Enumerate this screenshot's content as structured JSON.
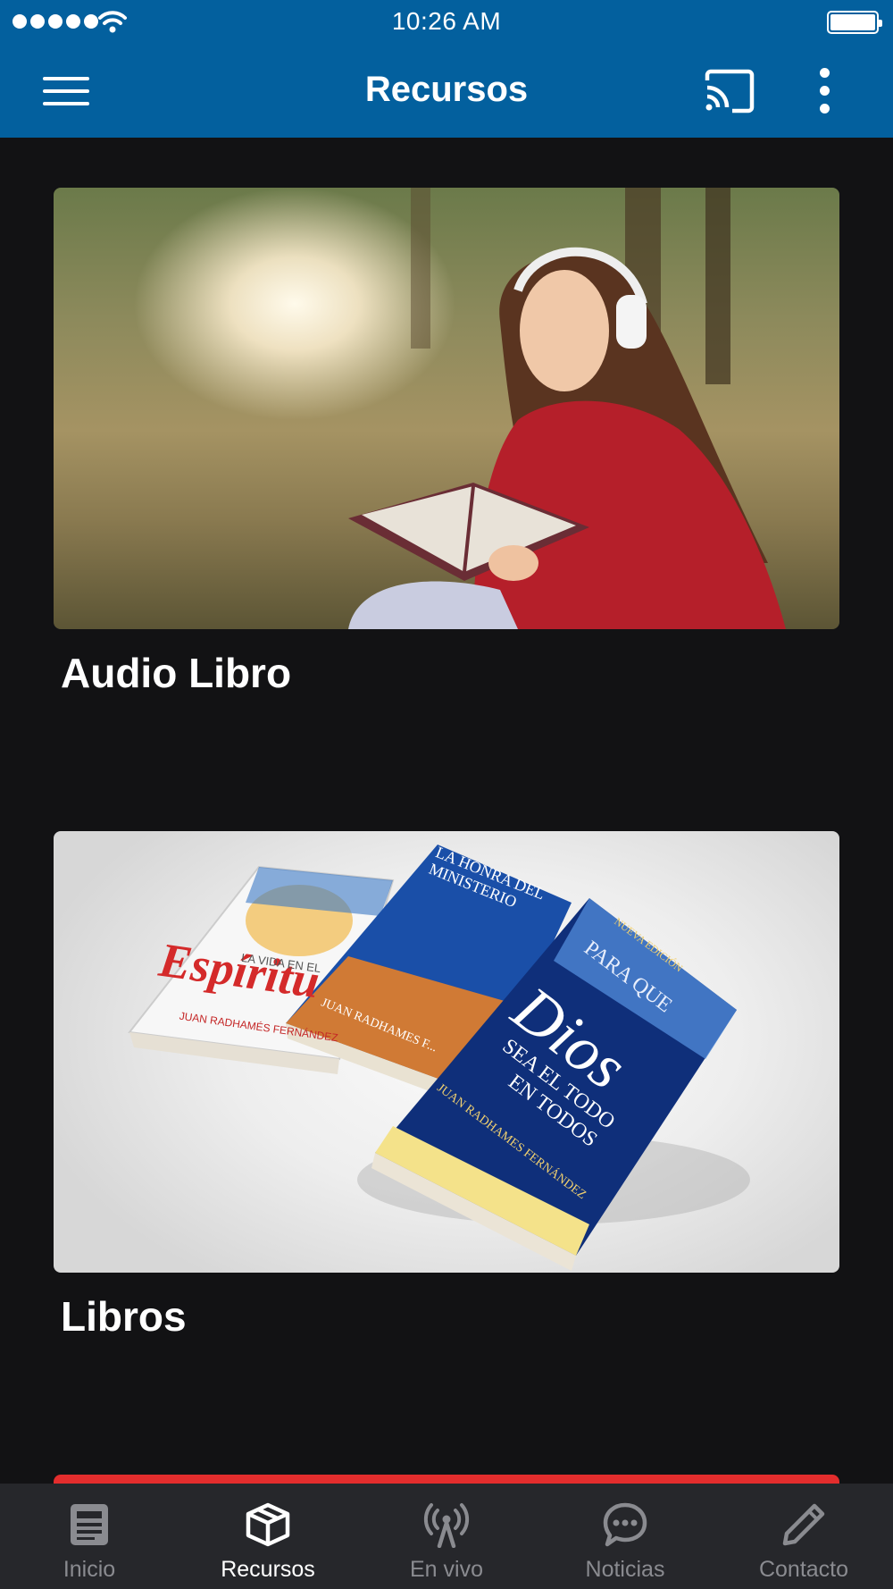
{
  "status_bar": {
    "time": "10:26 AM"
  },
  "app_bar": {
    "title": "Recursos",
    "menu_icon": "hamburger-menu-icon",
    "cast_icon": "cast-icon",
    "more_icon": "more-vert-icon"
  },
  "cards": [
    {
      "title": "Audio Libro",
      "image": "woman-reading-book-with-headphones"
    },
    {
      "title": "Libros",
      "image": "stack-of-books"
    }
  ],
  "book_covers": {
    "left": {
      "title": "Espíritu",
      "header": "LA VIDA EN EL",
      "author": "JUAN RADHAMÉS FERNÁNDEZ"
    },
    "middle": {
      "title": "LA HONRA DEL MINISTERIO",
      "author": "JUAN RADHAMES F..."
    },
    "right": {
      "badge": "NUEVA EDICIÓN",
      "line1": "PARA QUE",
      "line2": "Dios",
      "line3": "SEA EL TODO",
      "line4": "EN TODOS",
      "author": "JUAN RADHAMES FERNÁNDEZ"
    }
  },
  "bottom_nav": {
    "items": [
      {
        "label": "Inicio",
        "icon": "news-icon",
        "active": false
      },
      {
        "label": "Recursos",
        "icon": "box-icon",
        "active": true
      },
      {
        "label": "En vivo",
        "icon": "broadcast-icon",
        "active": false
      },
      {
        "label": "Noticias",
        "icon": "chat-bubble-icon",
        "active": false
      },
      {
        "label": "Contacto",
        "icon": "pencil-icon",
        "active": false
      }
    ]
  },
  "colors": {
    "header": "#03609e",
    "background": "#121214",
    "nav_background": "#26272b",
    "accent_strip": "#e32d2d"
  }
}
